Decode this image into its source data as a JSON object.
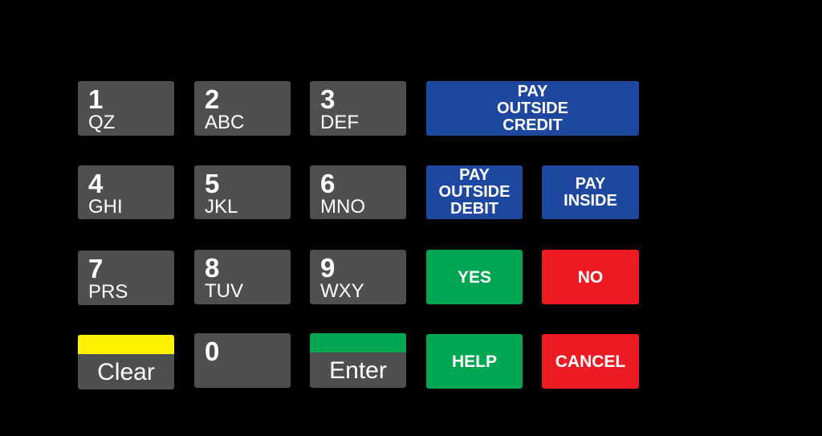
{
  "keypad": {
    "numeric": [
      {
        "digit": "1",
        "letters": "QZ"
      },
      {
        "digit": "2",
        "letters": "ABC"
      },
      {
        "digit": "3",
        "letters": "DEF"
      },
      {
        "digit": "4",
        "letters": "GHI"
      },
      {
        "digit": "5",
        "letters": "JKL"
      },
      {
        "digit": "6",
        "letters": "MNO"
      },
      {
        "digit": "7",
        "letters": "PRS"
      },
      {
        "digit": "8",
        "letters": "TUV"
      },
      {
        "digit": "9",
        "letters": "WXY"
      },
      {
        "digit": "0",
        "letters": ""
      }
    ],
    "clear": {
      "label": "Clear",
      "stripe_color": "#fff200"
    },
    "enter": {
      "label": "Enter",
      "stripe_color": "#00a651"
    },
    "pay_outside_credit": [
      "PAY",
      "OUTSIDE",
      "CREDIT"
    ],
    "pay_outside_debit": [
      "PAY",
      "OUTSIDE",
      "DEBIT"
    ],
    "pay_inside": [
      "PAY",
      "INSIDE"
    ],
    "yes": "YES",
    "no": "NO",
    "help": "HELP",
    "cancel": "CANCEL"
  },
  "colors": {
    "numeric_key": "#4e4f4f",
    "pay_key": "#1e48a0",
    "affirm_key": "#00a651",
    "negate_key": "#ed1c24",
    "background": "#000000"
  }
}
